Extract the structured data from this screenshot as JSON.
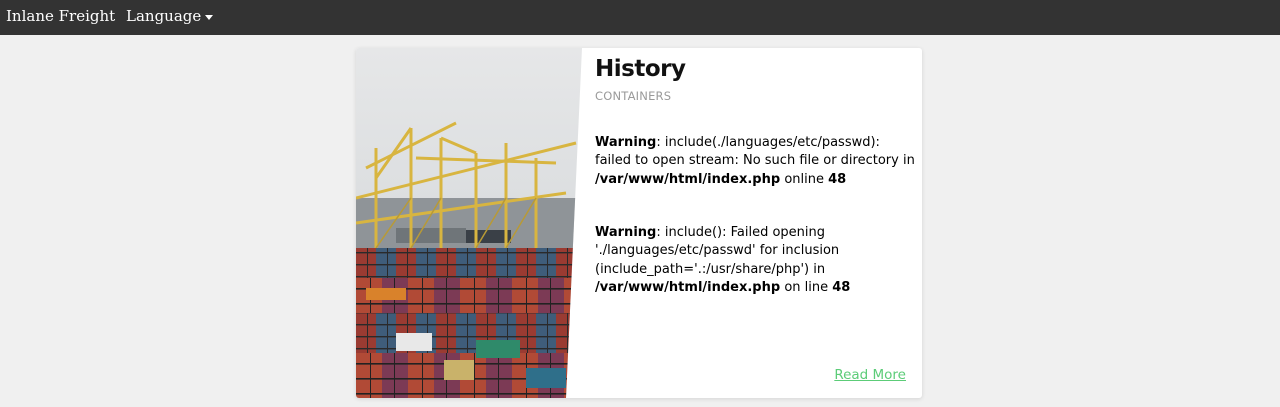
{
  "navbar": {
    "brand": "Inlane Freight",
    "language_label": "Language"
  },
  "card": {
    "title": "History",
    "subtitle": "CONTAINERS",
    "warnings": [
      {
        "label": "Warning",
        "message": ": include(./languages/etc/passwd): failed to open stream: No such file or directory in ",
        "file": "/var/www/html/index.php",
        "on_line": " online ",
        "line": "48"
      },
      {
        "label": "Warning",
        "message": ": include(): Failed opening './languages/etc/passwd' for inclusion (include_path='.:/usr/share/php') in ",
        "file": "/var/www/html/index.php",
        "on_line": " on line ",
        "line": "48"
      }
    ],
    "read_more": "Read More"
  },
  "colors": {
    "navbar_bg": "#333333",
    "page_bg": "#f0f0f0",
    "card_bg": "#ffffff",
    "link_green": "#5ccc78",
    "crane_yellow": "#d8b540"
  },
  "icons": {
    "language_caret": "caret-down-icon",
    "card_image": "shipping-port-photo"
  }
}
